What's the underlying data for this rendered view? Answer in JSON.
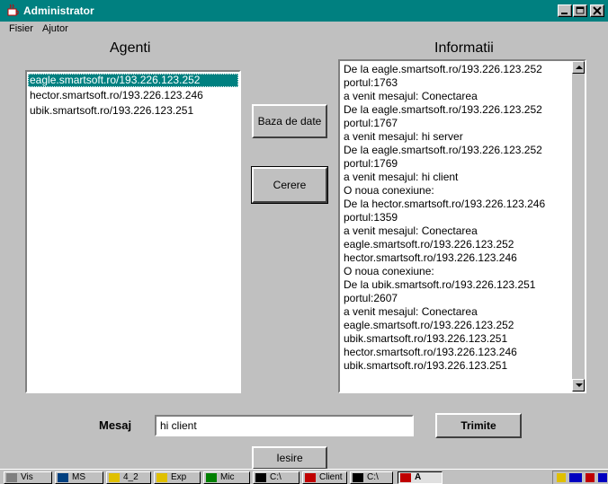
{
  "window": {
    "title": "Administrator"
  },
  "menu": {
    "items": [
      "Fisier",
      "Ajutor"
    ]
  },
  "agents": {
    "heading": "Agenti",
    "items": [
      "eagle.smartsoft.ro/193.226.123.252",
      "hector.smartsoft.ro/193.226.123.246",
      "ubik.smartsoft.ro/193.226.123.251"
    ],
    "selected_index": 0
  },
  "buttons": {
    "database": "Baza de date",
    "request": "Cerere",
    "send": "Trimite",
    "exit": "Iesire"
  },
  "info": {
    "heading": "Informatii",
    "lines": [
      "De la eagle.smartsoft.ro/193.226.123.252",
      "portul:1763",
      "a venit mesajul: Conectarea",
      "De la eagle.smartsoft.ro/193.226.123.252",
      "portul:1767",
      "a venit mesajul: hi server",
      "De la eagle.smartsoft.ro/193.226.123.252",
      "portul:1769",
      "a venit mesajul: hi client",
      "O noua conexiune:",
      "De la hector.smartsoft.ro/193.226.123.246",
      "portul:1359",
      "a venit mesajul: Conectarea",
      "eagle.smartsoft.ro/193.226.123.252",
      "hector.smartsoft.ro/193.226.123.246",
      "O noua conexiune:",
      "De la ubik.smartsoft.ro/193.226.123.251",
      "portul:2607",
      "a venit mesajul: Conectarea",
      "eagle.smartsoft.ro/193.226.123.252",
      "ubik.smartsoft.ro/193.226.123.251",
      "hector.smartsoft.ro/193.226.123.246",
      "ubik.smartsoft.ro/193.226.123.251"
    ]
  },
  "message": {
    "label": "Mesaj",
    "value": "hi client"
  },
  "taskbar": {
    "tasks": [
      "Vis",
      "MS",
      "4_2",
      "Exp",
      "Mic",
      "C:\\",
      "Client",
      "C:\\",
      "A"
    ]
  },
  "colors": {
    "titlebar": "#008080",
    "selection": "#008080",
    "face": "#c0c0c0"
  }
}
